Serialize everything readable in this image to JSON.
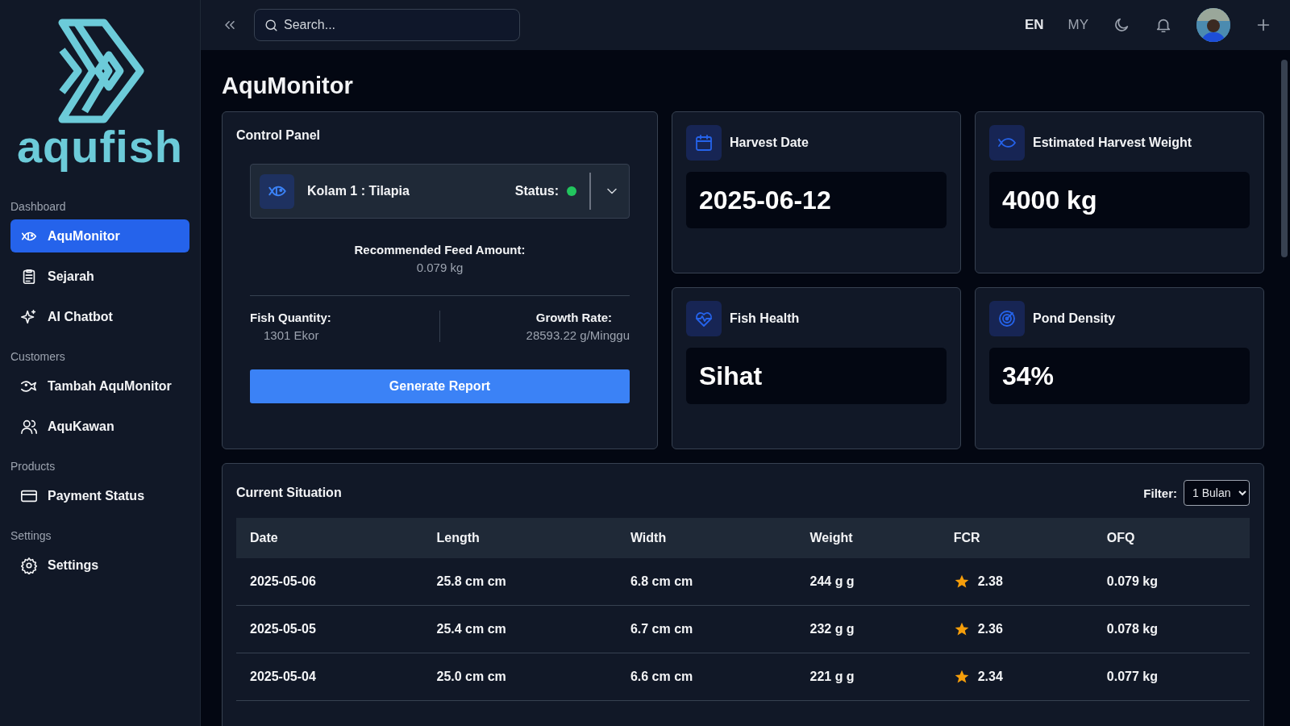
{
  "sidebar": {
    "logo_text": "aqufish",
    "sections": [
      {
        "title": "Dashboard",
        "items": [
          {
            "label": "AquMonitor",
            "selected": true
          },
          {
            "label": "Sejarah",
            "selected": false
          },
          {
            "label": "AI Chatbot",
            "selected": false
          }
        ]
      },
      {
        "title": "Customers",
        "items": [
          {
            "label": "Tambah AquMonitor",
            "selected": false
          },
          {
            "label": "AquKawan",
            "selected": false
          }
        ]
      },
      {
        "title": "Products",
        "items": [
          {
            "label": "Payment Status",
            "selected": false
          }
        ]
      },
      {
        "title": "Settings",
        "items": [
          {
            "label": "Settings",
            "selected": false
          }
        ]
      }
    ]
  },
  "topbar": {
    "search": {
      "placeholder": "Search..."
    },
    "languages": [
      {
        "label": "EN",
        "selected": true
      },
      {
        "label": "MY",
        "selected": false
      }
    ]
  },
  "page_title": "AquMonitor",
  "control_panel": {
    "title": "Control Panel",
    "pond": {
      "label": "Kolam 1 : Tilapia",
      "status_label": "Status:",
      "status_on": true
    },
    "feed": {
      "label": "Recommended Feed Amount:",
      "value": "0.079 kg"
    },
    "quantity": {
      "label": "Fish Quantity:",
      "value": "1301 Ekor"
    },
    "growth": {
      "label": "Growth Rate:",
      "value": "28593.22 g/Minggu"
    },
    "button": "Generate Report"
  },
  "stats": [
    {
      "title": "Harvest Date",
      "value": "2025-06-12"
    },
    {
      "title": "Estimated Harvest Weight",
      "value": "4000 kg"
    },
    {
      "title": "Fish Health",
      "value": "Sihat"
    },
    {
      "title": "Pond Density",
      "value": "34%"
    }
  ],
  "current_situation": {
    "title": "Current Situation",
    "filter_label": "Filter:",
    "filter_value": "1 Bulan",
    "table": {
      "columns": [
        "Date",
        "Length",
        "Width",
        "Weight",
        "FCR",
        "OFQ"
      ],
      "rows": [
        [
          "2025-05-06",
          "25.8 cm cm",
          "6.8 cm cm",
          "244 g g",
          "2.38",
          "0.079 kg"
        ],
        [
          "2025-05-05",
          "25.4 cm cm",
          "6.7 cm cm",
          "232 g g",
          "2.36",
          "0.078 kg"
        ],
        [
          "2025-05-04",
          "25.0 cm cm",
          "6.6 cm cm",
          "221 g g",
          "2.34",
          "0.077 kg"
        ]
      ]
    }
  }
}
